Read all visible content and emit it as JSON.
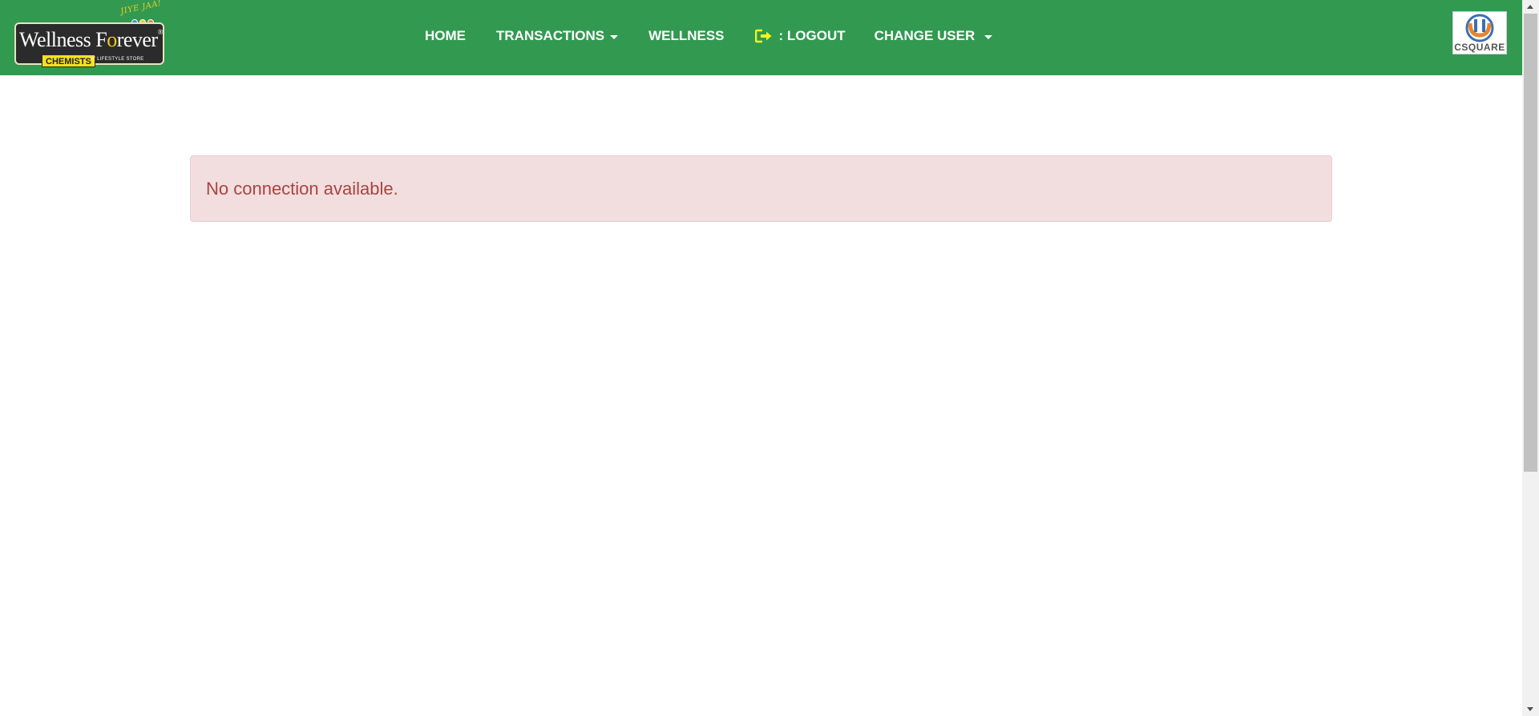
{
  "brand": {
    "tagline": "JIYE JAA!",
    "name_part1": "Wellness F",
    "name_accent": "o",
    "name_part2": "rever",
    "registered_mark": "®",
    "chemists": "CHEMISTS",
    "subtitle": "'A' LIFESTYLE STORE",
    "dot_colors": [
      "#3a8fd6",
      "#f3c81d",
      "#e8842b"
    ]
  },
  "nav": {
    "home": "HOME",
    "transactions": "TRANSACTIONS",
    "wellness": "WELLNESS",
    "logout": ": LOGOUT",
    "change_user": "CHANGE USER"
  },
  "partner_logo": {
    "text": "CSQUARE"
  },
  "alert": {
    "message": "No connection available."
  },
  "colors": {
    "navbar": "#319a50",
    "alert_bg": "#f2dede",
    "alert_text": "#a94442",
    "logout_icon": "#f4f41e"
  },
  "icons": {
    "logout": "logout-icon",
    "dropdown": "caret-down-icon"
  }
}
